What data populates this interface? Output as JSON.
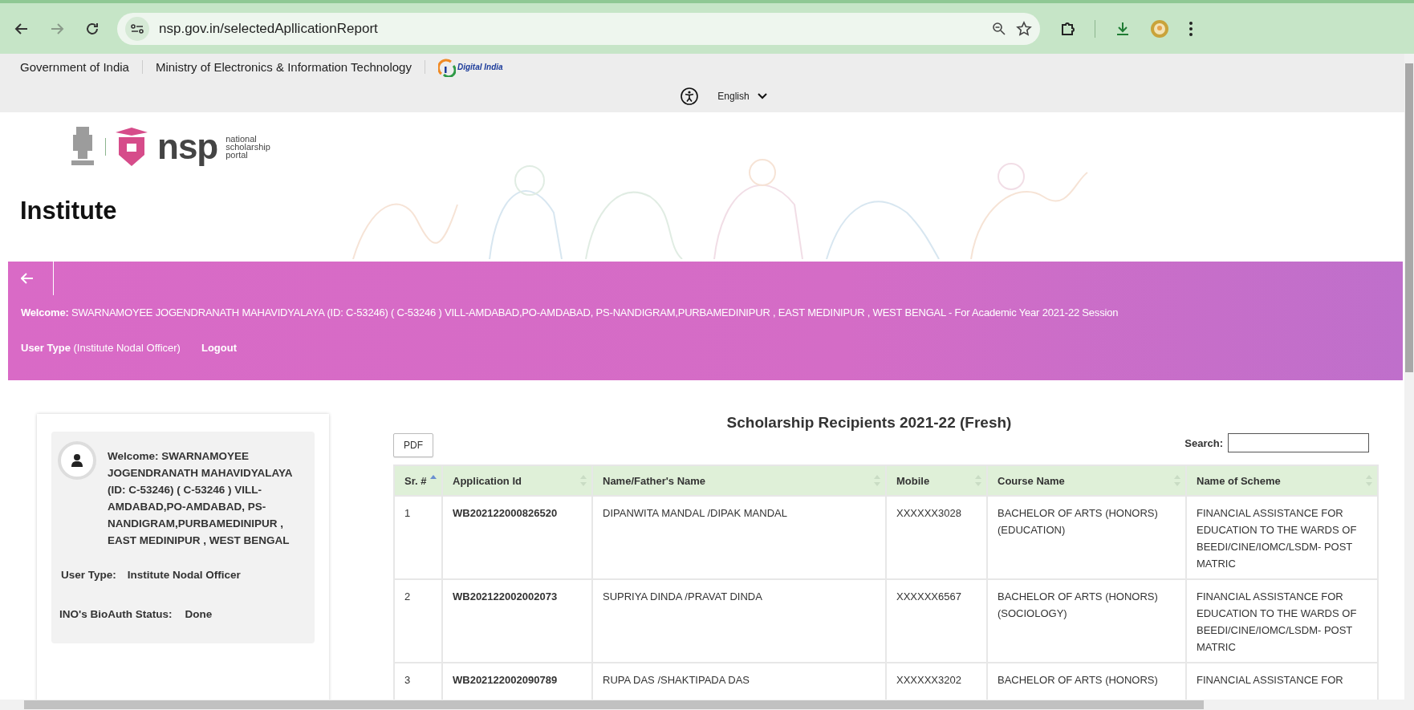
{
  "browser": {
    "url": "nsp.gov.in/selectedApllicationReport"
  },
  "gov_bar": {
    "items": [
      "Government of India",
      "Ministry of Electronics & Information Technology"
    ],
    "logo_text": "Digital India"
  },
  "language": {
    "label": "English"
  },
  "header": {
    "logo_text": "nsp",
    "logo_tagline": [
      "national",
      "scholarship",
      "portal"
    ],
    "title": "Institute"
  },
  "banner": {
    "welcome": "**Welcome:** SWARNAMOYEE JOGENDRANATH MAHAVIDYALAYA (ID: C-53246) ( C-53246 ) VILL-AMDABAD,PO-AMDABAD, PS-NANDIGRAM,PURBAMEDINIPUR , EAST MEDINIPUR , WEST BENGAL - For Academic Year 2021-22 Session",
    "user_type": "**User Type** (Institute Nodal Officer)",
    "logout": "Logout"
  },
  "profile": {
    "welcome": "Welcome: SWARNAMOYEE JOGENDRANATH MAHAVIDYALAYA (ID: C-53246) ( C-53246 ) VILL-AMDABAD,PO-AMDABAD, PS-NANDIGRAM,PURBAMEDINIPUR , EAST MEDINIPUR , WEST BENGAL",
    "user_type_label": "User Type:",
    "user_type": "Institute Nodal Officer",
    "bioauth_label": "INO's BioAuth Status:",
    "bioauth": "Done"
  },
  "report": {
    "title": "Scholarship Recipients 2021-22 (Fresh)",
    "pdf": "PDF",
    "search_label": "Search:",
    "columns": [
      {
        "label": "Sr. #",
        "sorted": true
      },
      {
        "label": "Application Id",
        "sorted": false
      },
      {
        "label": "Name/Father's Name",
        "sorted": false
      },
      {
        "label": "Mobile",
        "sorted": false
      },
      {
        "label": "Course Name",
        "sorted": false
      },
      {
        "label": "Name of Scheme",
        "sorted": false
      }
    ],
    "rows": [
      [
        "1",
        "WB202122000826520",
        "DIPANWITA MANDAL /DIPAK MANDAL",
        "XXXXXX3028",
        "BACHELOR OF ARTS (HONORS) (EDUCATION)",
        "FINANCIAL ASSISTANCE FOR EDUCATION TO THE WARDS OF BEEDI/CINE/IOMC/LSDM- POST MATRIC"
      ],
      [
        "2",
        "WB202122002002073",
        "SUPRIYA DINDA /PRAVAT DINDA",
        "XXXXXX6567",
        "BACHELOR OF ARTS (HONORS) (SOCIOLOGY)",
        "FINANCIAL ASSISTANCE FOR EDUCATION TO THE WARDS OF BEEDI/CINE/IOMC/LSDM- POST MATRIC"
      ],
      [
        "3",
        "WB202122002090789",
        "RUPA DAS /SHAKTIPADA DAS",
        "XXXXXX3202",
        "BACHELOR OF ARTS (HONORS)",
        "FINANCIAL ASSISTANCE FOR"
      ]
    ]
  }
}
